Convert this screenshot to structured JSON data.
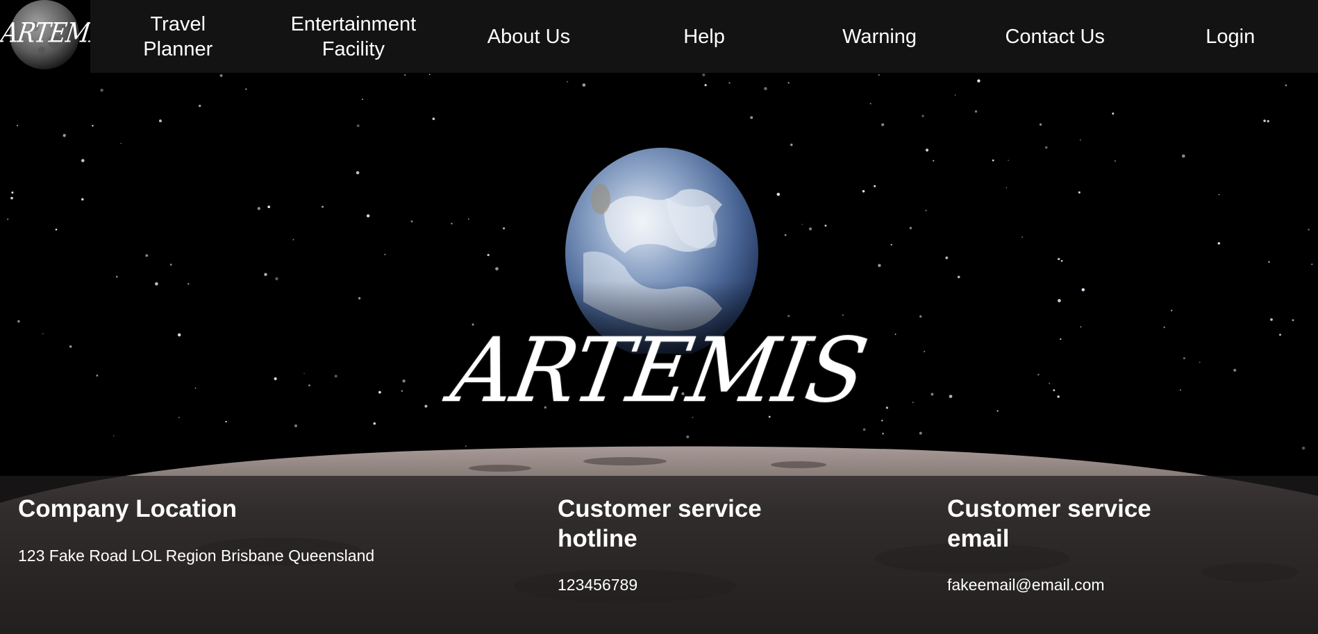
{
  "nav": {
    "logo_text": "ARTEMIS",
    "items": [
      {
        "label": "Travel\nPlanner"
      },
      {
        "label": "Entertainment\nFacility"
      },
      {
        "label": "About Us"
      },
      {
        "label": "Help"
      },
      {
        "label": "Warning"
      },
      {
        "label": "Contact Us"
      },
      {
        "label": "Login"
      }
    ]
  },
  "hero": {
    "brand_text": "ARTEMIS"
  },
  "footer": {
    "location": {
      "heading": "Company Location",
      "value": "123 Fake Road LOL Region Brisbane Queensland"
    },
    "hotline": {
      "heading": "Customer service hotline",
      "value": "123456789"
    },
    "email": {
      "heading": "Customer service email",
      "value": "fakeemail@email.com"
    }
  }
}
